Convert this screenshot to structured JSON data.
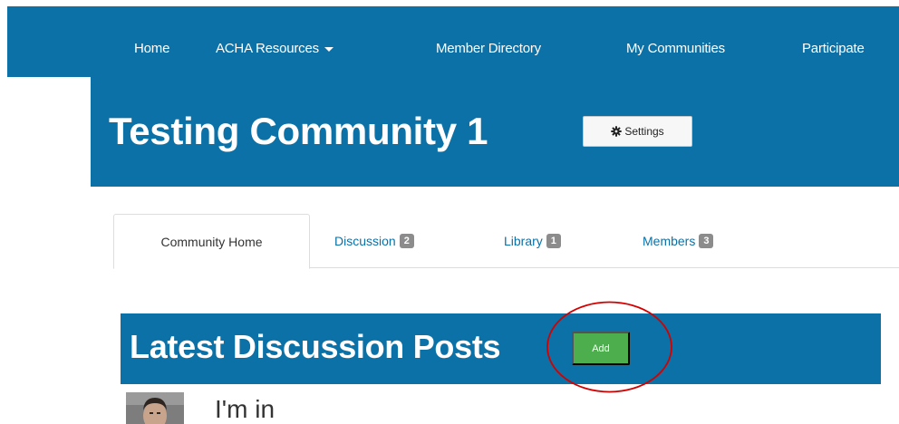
{
  "nav": {
    "items": [
      {
        "label": "Home"
      },
      {
        "label": "ACHA Resources",
        "has_dropdown": true
      },
      {
        "label": "Member Directory"
      },
      {
        "label": "My Communities"
      },
      {
        "label": "Participate"
      }
    ]
  },
  "community": {
    "title": "Testing Community 1",
    "settings_label": "Settings",
    "settings_icon": "gear-icon"
  },
  "tabs": [
    {
      "label": "Community Home",
      "active": true
    },
    {
      "label": "Discussion",
      "count": "2"
    },
    {
      "label": "Library",
      "count": "1"
    },
    {
      "label": "Members",
      "count": "3"
    }
  ],
  "posts": {
    "title": "Latest Discussion Posts",
    "add_label": "Add",
    "items": [
      {
        "title": "I'm in"
      }
    ]
  },
  "colors": {
    "brand_blue": "#0b71a6",
    "add_green": "#4cae4c",
    "badge_gray": "#8c8c8c",
    "annotation_red": "#d40000"
  }
}
